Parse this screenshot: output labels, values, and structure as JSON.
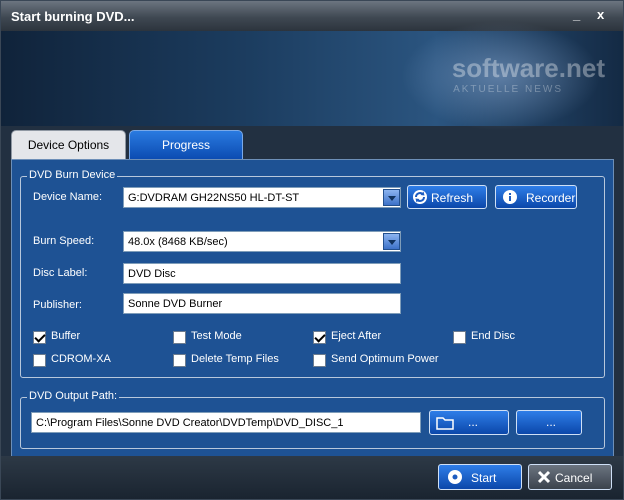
{
  "window": {
    "title": "Start burning DVD...",
    "minimize_label": "_",
    "close_label": "x"
  },
  "banner": {
    "watermark": "software.net",
    "watermark_sub": "AKTUELLE NEWS"
  },
  "tabs": [
    {
      "label": "Device Options"
    },
    {
      "label": "Progress"
    }
  ],
  "burn_group": {
    "legend": "DVD Burn Device",
    "device_name_label": "Device Name:",
    "device_name_value": "G:DVDRAM GH22NS50 HL-DT-ST",
    "refresh_label": "Refresh",
    "recorder_label": "Recorder",
    "burn_speed_label": "Burn Speed:",
    "burn_speed_value": "48.0x (8468 KB/sec)",
    "disc_label_label": "Disc Label:",
    "disc_label_value": "DVD Disc",
    "publisher_label": "Publisher:",
    "publisher_value": "Sonne DVD Burner"
  },
  "options": [
    {
      "label": "Buffer",
      "checked": true
    },
    {
      "label": "Test Mode",
      "checked": false
    },
    {
      "label": "Eject After",
      "checked": true
    },
    {
      "label": "End Disc",
      "checked": false
    },
    {
      "label": "CDROM-XA",
      "checked": false
    },
    {
      "label": "Delete Temp Files",
      "checked": false
    },
    {
      "label": "Send Optimum Power",
      "checked": false
    }
  ],
  "output_group": {
    "legend": "DVD Output Path:",
    "path_value": "C:\\Program Files\\Sonne DVD Creator\\DVDTemp\\DVD_DISC_1",
    "browse_label": "...",
    "extra_label": "..."
  },
  "footer": {
    "start_label": "Start",
    "cancel_label": "Cancel"
  }
}
